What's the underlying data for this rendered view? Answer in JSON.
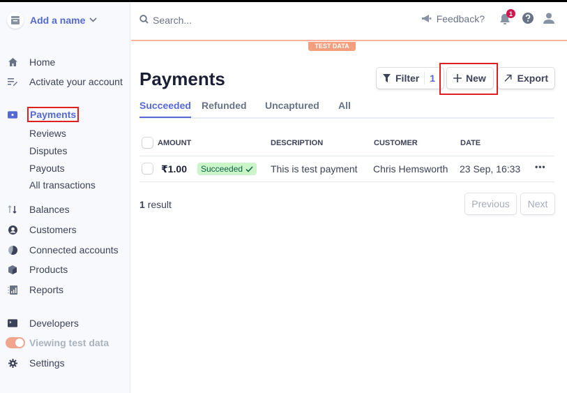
{
  "sidebar": {
    "account_name": "Add a name",
    "items": [
      {
        "label": "Home",
        "icon": "home-icon"
      },
      {
        "label": "Activate your account",
        "icon": "edit-list-icon"
      },
      {
        "label": "Payments",
        "icon": "wallet-icon",
        "active": true
      },
      {
        "label": "Balances",
        "icon": "arrows-icon"
      },
      {
        "label": "Customers",
        "icon": "user-circle-icon"
      },
      {
        "label": "Connected accounts",
        "icon": "pie-icon"
      },
      {
        "label": "Products",
        "icon": "box-icon"
      },
      {
        "label": "Reports",
        "icon": "chart-icon"
      },
      {
        "label": "Developers",
        "icon": "terminal-icon"
      },
      {
        "label": "Viewing test data",
        "icon": "toggle"
      },
      {
        "label": "Settings",
        "icon": "gear-icon"
      }
    ],
    "payments_sub": [
      "Reviews",
      "Disputes",
      "Payouts",
      "All transactions"
    ]
  },
  "header": {
    "search_placeholder": "Search...",
    "feedback_label": "Feedback?",
    "notification_count": "1",
    "test_data_label": "TEST DATA"
  },
  "main": {
    "title": "Payments",
    "filter_label": "Filter",
    "filter_count": "1",
    "new_label": "New",
    "export_label": "Export",
    "tabs": [
      "Succeeded",
      "Refunded",
      "Uncaptured",
      "All"
    ],
    "columns": [
      "AMOUNT",
      "DESCRIPTION",
      "CUSTOMER",
      "DATE"
    ],
    "rows": [
      {
        "amount": "₹1.00",
        "status": "Succeeded",
        "description": "This is test payment",
        "customer": "Chris Hemsworth",
        "date": "23 Sep, 16:33"
      }
    ],
    "result_count": "1",
    "result_label": "result",
    "prev_label": "Previous",
    "next_label": "Next"
  },
  "colors": {
    "accent": "#5469d4",
    "test_mode": "#f39f7e",
    "success_bg": "#cbf4c9",
    "highlight": "#e02020"
  }
}
